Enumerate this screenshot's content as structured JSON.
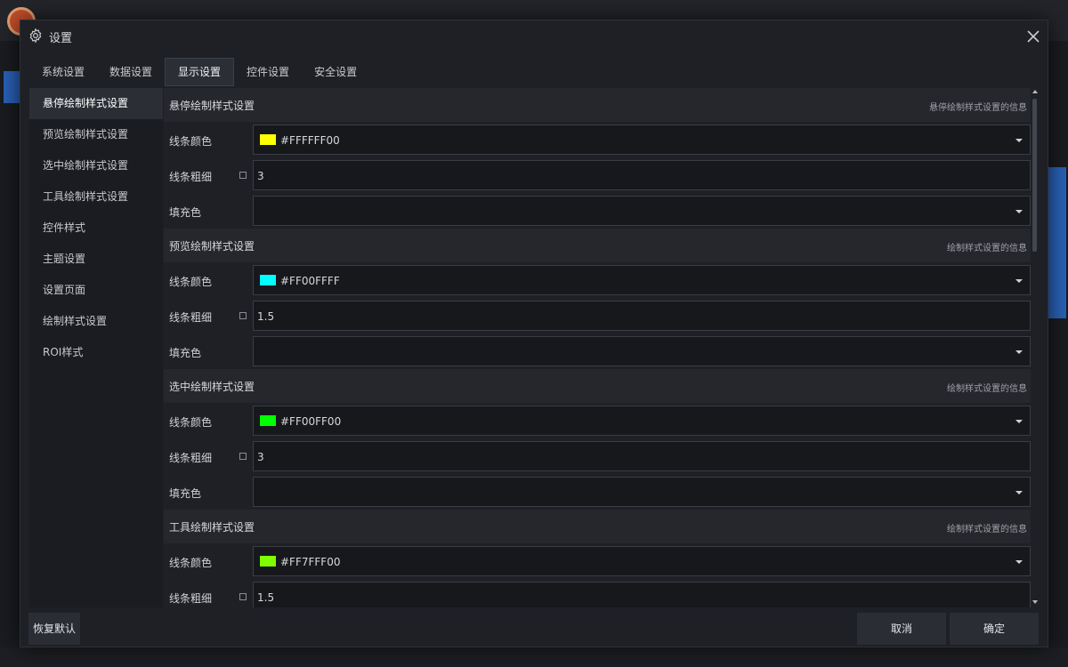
{
  "dialog": {
    "title": "设置",
    "close_icon": "close-icon",
    "gear_icon": "gear-icon"
  },
  "tabs": [
    {
      "label": "系统设置",
      "active": false
    },
    {
      "label": "数据设置",
      "active": false
    },
    {
      "label": "显示设置",
      "active": true
    },
    {
      "label": "控件设置",
      "active": false
    },
    {
      "label": "安全设置",
      "active": false
    }
  ],
  "sidebar": {
    "items": [
      {
        "label": "悬停绘制样式设置",
        "active": true
      },
      {
        "label": "预览绘制样式设置",
        "active": false
      },
      {
        "label": "选中绘制样式设置",
        "active": false
      },
      {
        "label": "工具绘制样式设置",
        "active": false
      },
      {
        "label": "控件样式",
        "active": false
      },
      {
        "label": "主题设置",
        "active": false
      },
      {
        "label": "设置页面",
        "active": false
      },
      {
        "label": "绘制样式设置",
        "active": false
      },
      {
        "label": "ROI样式",
        "active": false
      }
    ]
  },
  "sections": [
    {
      "title": "悬停绘制样式设置",
      "info": "悬停绘制样式设置的信息",
      "line_color_label": "线条颜色",
      "line_color_value": "#FFFFFF00",
      "swatch": "#ffff00",
      "line_width_label": "线条粗细",
      "line_width_value": "3",
      "fill_label": "填充色",
      "fill_value": ""
    },
    {
      "title": "预览绘制样式设置",
      "info": "绘制样式设置的信息",
      "line_color_label": "线条颜色",
      "line_color_value": "#FF00FFFF",
      "swatch": "#00ffff",
      "line_width_label": "线条粗细",
      "line_width_value": "1.5",
      "fill_label": "填充色",
      "fill_value": ""
    },
    {
      "title": "选中绘制样式设置",
      "info": "绘制样式设置的信息",
      "line_color_label": "线条颜色",
      "line_color_value": "#FF00FF00",
      "swatch": "#00ff00",
      "line_width_label": "线条粗细",
      "line_width_value": "3",
      "fill_label": "填充色",
      "fill_value": ""
    },
    {
      "title": "工具绘制样式设置",
      "info": "绘制样式设置的信息",
      "line_color_label": "线条颜色",
      "line_color_value": "#FF7FFF00",
      "swatch": "#7fff00",
      "line_width_label": "线条粗细",
      "line_width_value": "1.5"
    }
  ],
  "footer": {
    "reset_label": "恢复默认",
    "cancel_label": "取消",
    "ok_label": "确定"
  }
}
